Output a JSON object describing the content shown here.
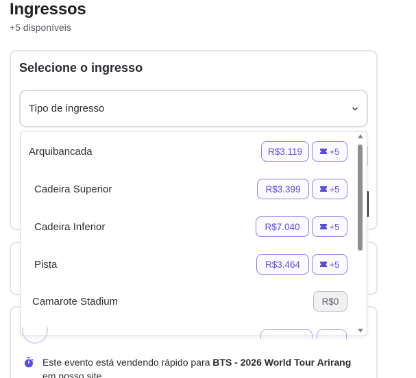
{
  "header": {
    "title": "Ingressos",
    "subtitle": "+5 disponíveis"
  },
  "selector": {
    "heading": "Selecione o ingresso",
    "select_label": "Tipo de ingresso"
  },
  "options": [
    {
      "name": "Arquibancada",
      "price": "R$3.119",
      "availability": "+5"
    },
    {
      "name": "Cadeira Superior",
      "price": "R$3.399",
      "availability": "+5"
    },
    {
      "name": "Cadeira Inferior",
      "price": "R$7.040",
      "availability": "+5"
    },
    {
      "name": "Pista",
      "price": "R$3.464",
      "availability": "+5"
    },
    {
      "name": "Camarote Stadium",
      "price": "R$0",
      "availability": ""
    }
  ],
  "promo": {
    "text_before": "Este evento está vendendo rápido para ",
    "event_name": "BTS - 2026 World Tour Arirang",
    "text_after": "em nosso site"
  },
  "colors": {
    "accent": "#5a4be0",
    "accent_border": "#8b7ff0",
    "card_border": "#e4e4e8",
    "zero_price_bg": "#f1f1f3"
  },
  "icons": {
    "select_chevron": "chevron-down-icon",
    "availability": "ticket-icon",
    "promo": "stopwatch-icon"
  }
}
